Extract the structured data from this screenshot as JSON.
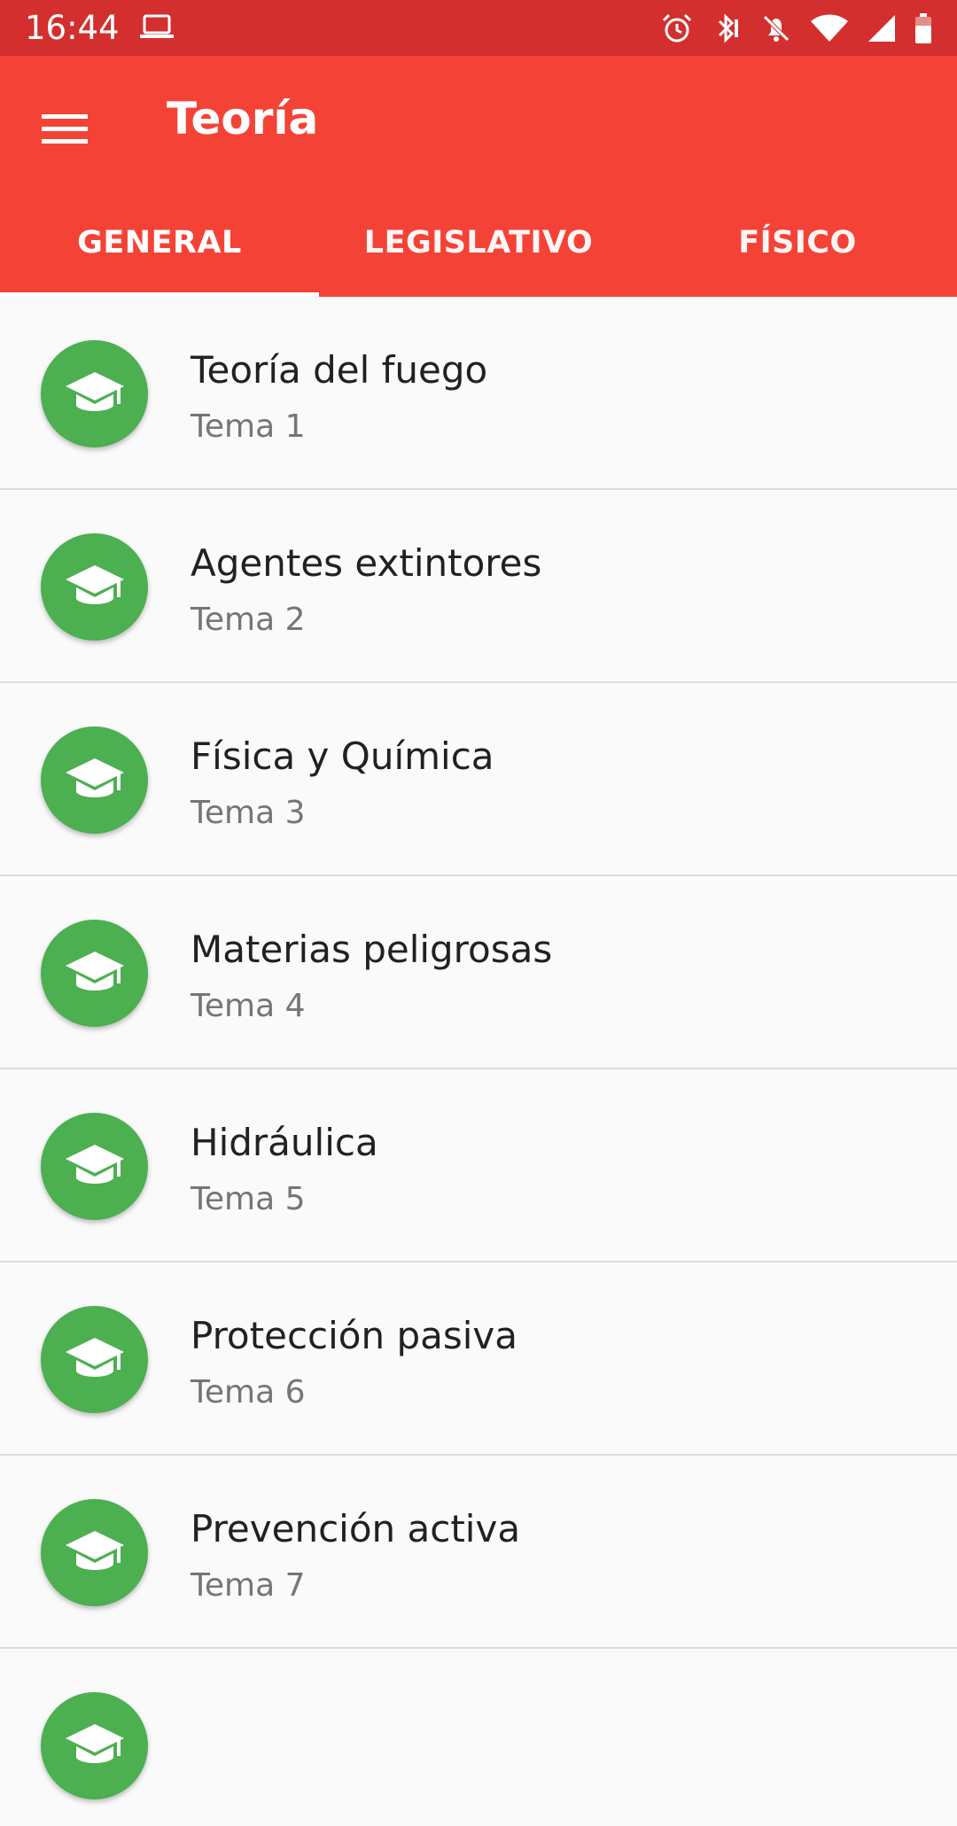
{
  "status_bar": {
    "time": "16:44",
    "icons": [
      "laptop-icon",
      "alarm-icon",
      "bluetooth-icon",
      "bell-off-icon",
      "wifi-icon",
      "signal-icon",
      "battery-icon"
    ]
  },
  "app_bar": {
    "title": "Teoría",
    "color": "#f44336",
    "status_color": "#d32f2f"
  },
  "tabs": [
    {
      "label": "GENERAL",
      "selected": true
    },
    {
      "label": "LEGISLATIVO",
      "selected": false
    },
    {
      "label": "FÍSICO",
      "selected": false
    }
  ],
  "items": [
    {
      "title": "Teoría del fuego",
      "subtitle": "Tema 1"
    },
    {
      "title": "Agentes extintores",
      "subtitle": "Tema 2"
    },
    {
      "title": "Física y Química",
      "subtitle": "Tema 3"
    },
    {
      "title": "Materias peligrosas",
      "subtitle": "Tema 4"
    },
    {
      "title": "Hidráulica",
      "subtitle": "Tema 5"
    },
    {
      "title": "Protección pasiva",
      "subtitle": "Tema 6"
    },
    {
      "title": "Prevención activa",
      "subtitle": "Tema 7"
    }
  ],
  "avatar_color": "#4caf50"
}
